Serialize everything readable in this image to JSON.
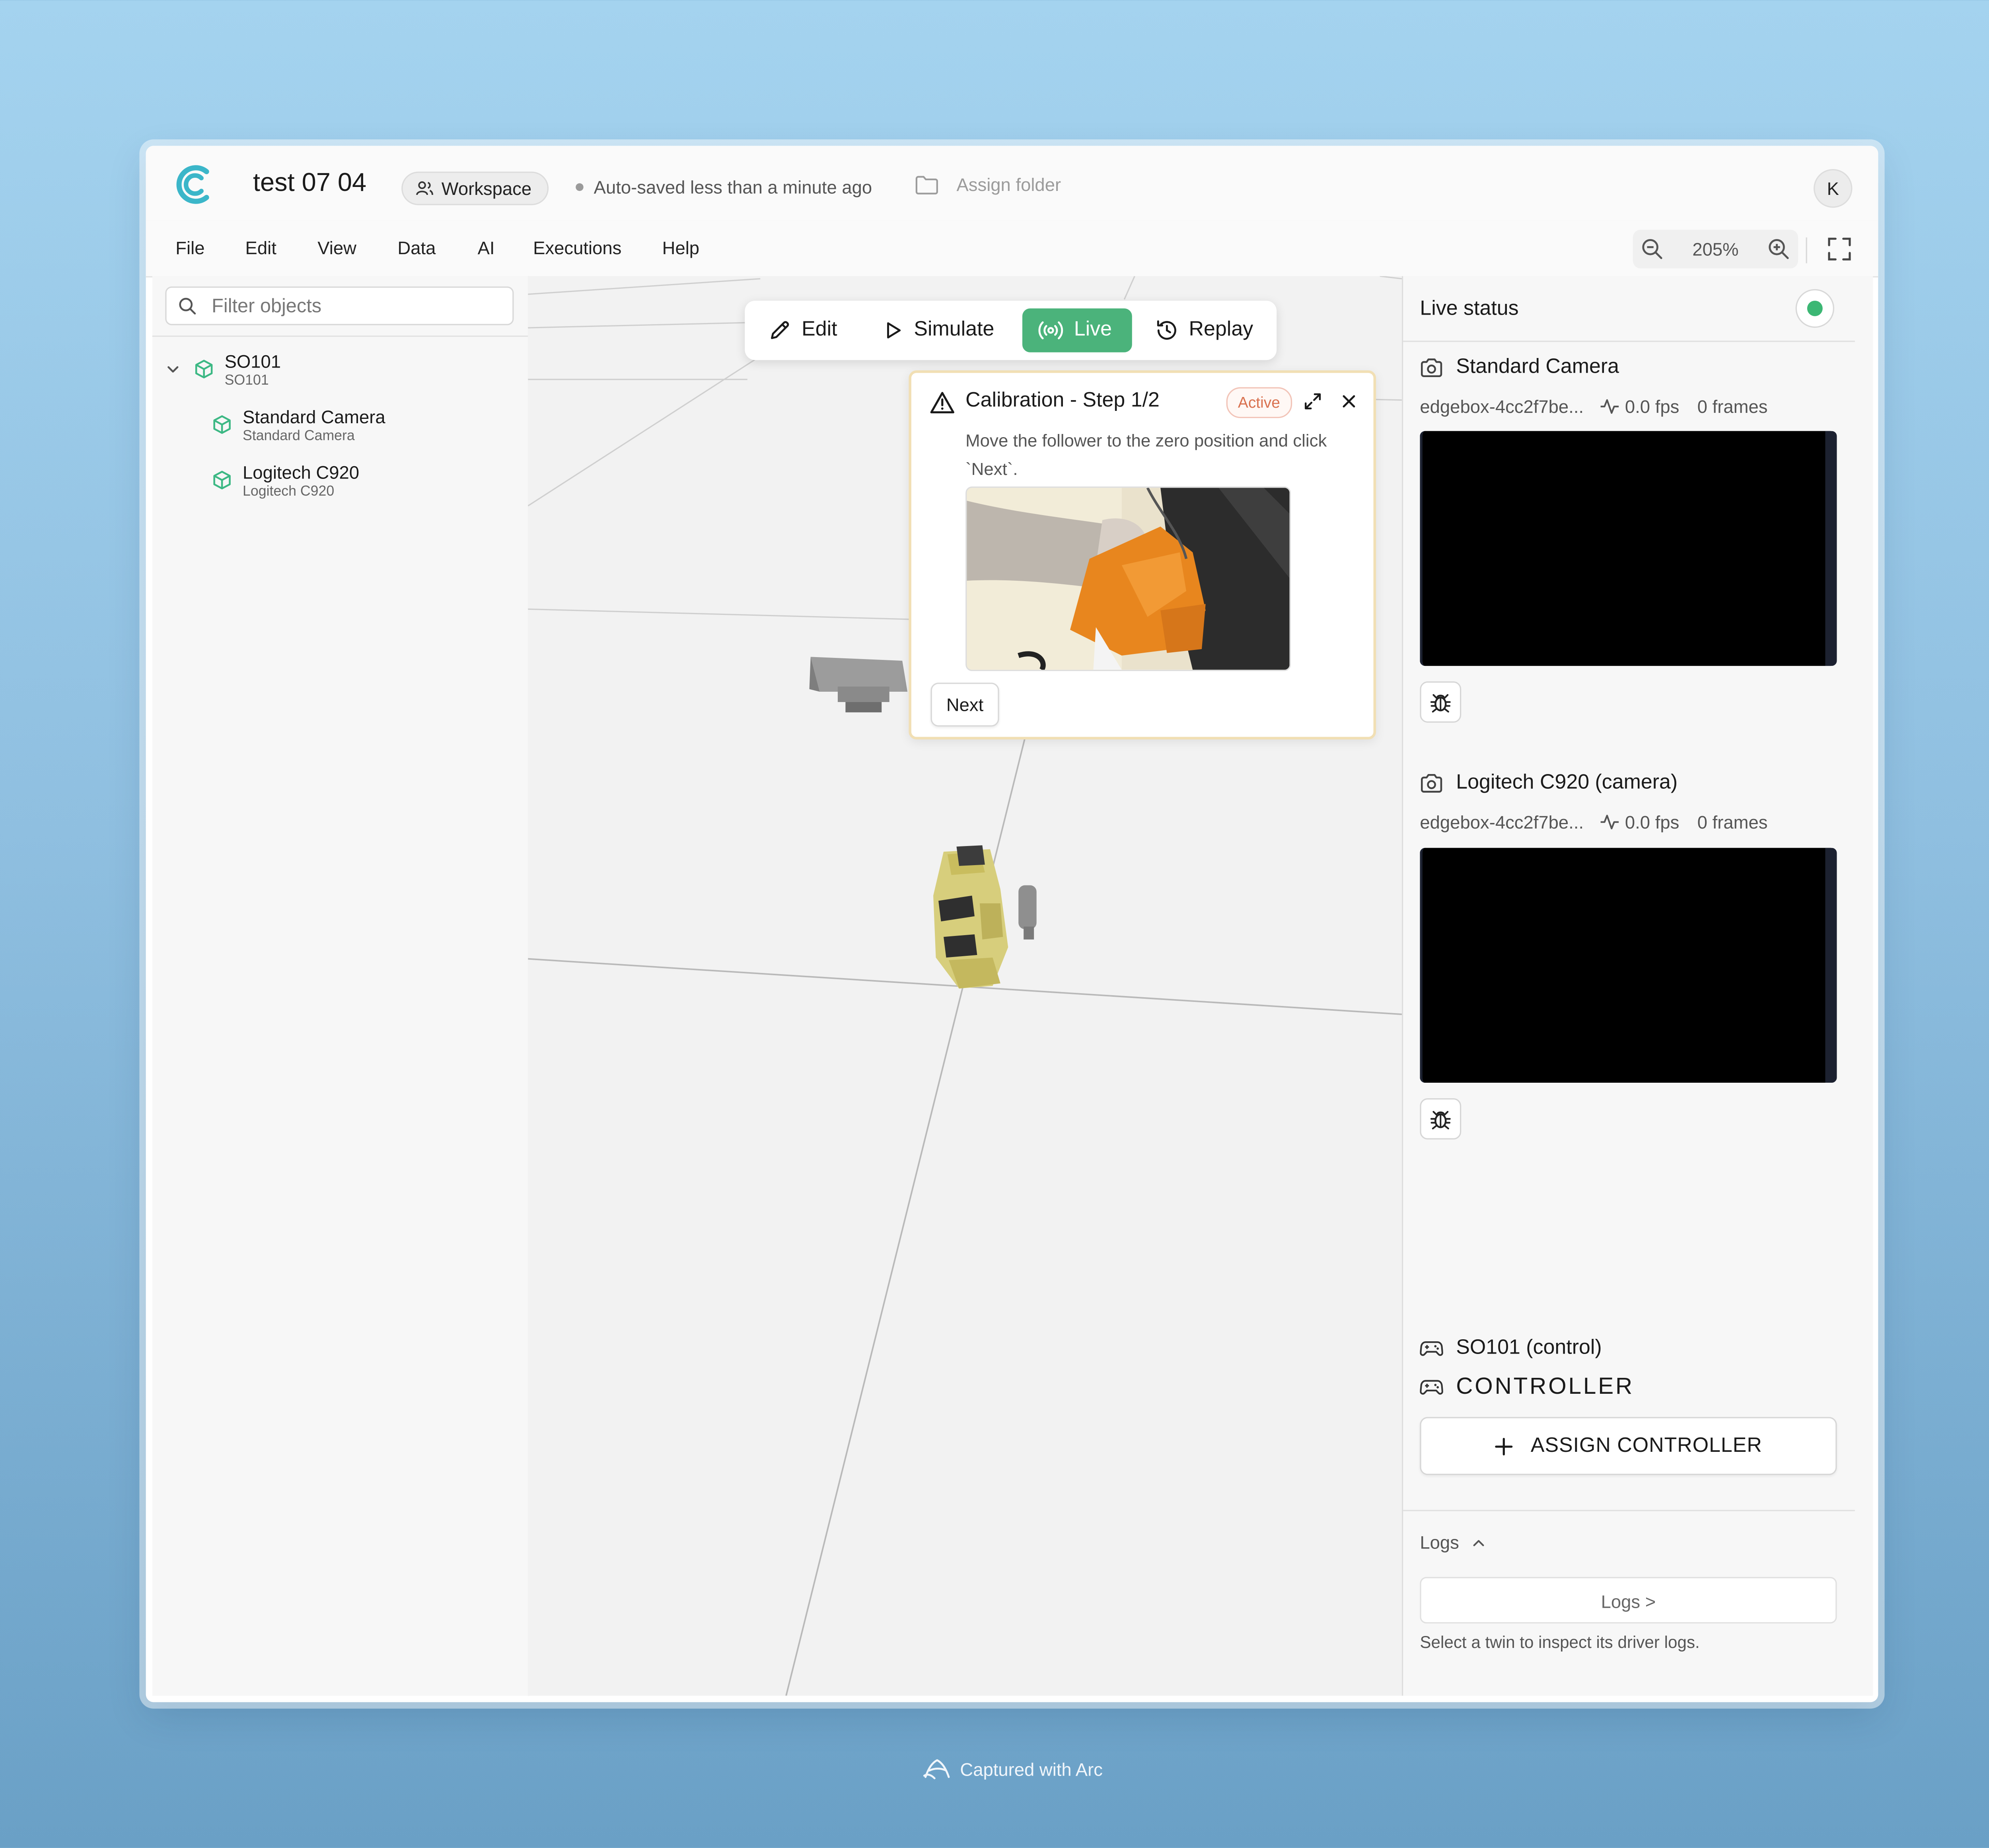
{
  "header": {
    "doc_title": "test 07 04",
    "workspace_label": "Workspace",
    "autosave": "Auto-saved less than a minute ago",
    "assign_folder": "Assign folder",
    "avatar_initial": "K"
  },
  "menu": {
    "items": [
      "File",
      "Edit",
      "View",
      "Data",
      "AI",
      "Executions",
      "Help"
    ],
    "zoom": "205%"
  },
  "left_panel": {
    "filter_placeholder": "Filter objects",
    "tree": [
      {
        "name": "SO101",
        "sub": "SO101"
      },
      {
        "name": "Standard Camera",
        "sub": "Standard Camera"
      },
      {
        "name": "Logitech C920",
        "sub": "Logitech C920"
      }
    ]
  },
  "modes": {
    "edit": "Edit",
    "simulate": "Simulate",
    "live": "Live",
    "replay": "Replay",
    "active": "Live"
  },
  "calibration": {
    "title": "Calibration - Step 1/2",
    "badge": "Active",
    "text": "Move the follower to the zero position and click `Next`.",
    "next": "Next"
  },
  "right_panel": {
    "title": "Live status",
    "status_color": "#3cb774",
    "cameras": [
      {
        "name": "Standard Camera",
        "device": "edgebox-4cc2f7be...",
        "fps": "0.0 fps",
        "frames": "0 frames"
      },
      {
        "name": "Logitech C920 (camera)",
        "device": "edgebox-4cc2f7be...",
        "fps": "0.0 fps",
        "frames": "0 frames"
      }
    ],
    "control_name": "SO101 (control)",
    "controller_heading": "CONTROLLER",
    "assign_controller": "ASSIGN CONTROLLER",
    "logs_heading": "Logs",
    "logs_button": "Logs >",
    "logs_hint": "Select a twin to inspect its driver logs."
  },
  "footer": {
    "captured": "Captured with Arc"
  },
  "colors": {
    "accent_green": "#4bb37b",
    "tree_icon": "#3cb884",
    "logo": "#3bb6c9"
  }
}
